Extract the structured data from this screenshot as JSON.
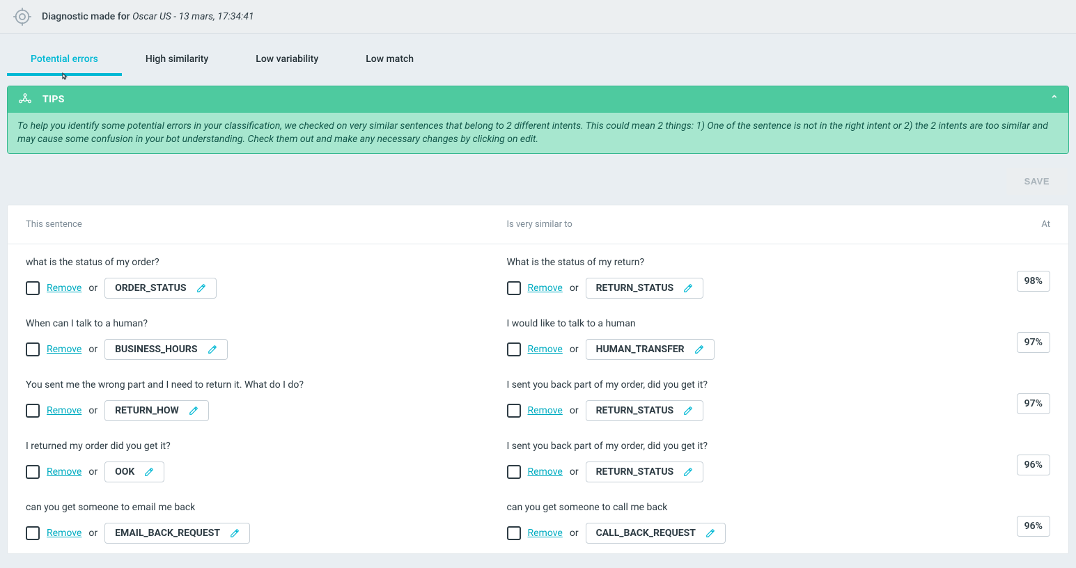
{
  "header": {
    "prefix": "Diagnostic made for ",
    "entity": "Oscar US - 13 mars, 17:34:41"
  },
  "tabs": [
    {
      "label": "Potential errors",
      "active": true
    },
    {
      "label": "High similarity",
      "active": false
    },
    {
      "label": "Low variability",
      "active": false
    },
    {
      "label": "Low match",
      "active": false
    }
  ],
  "tips": {
    "title": "TIPS",
    "body": "To help you identify some potential errors in your classification, we checked on very similar sentences that belong to 2 different intents. This could mean 2 things: 1) One of the sentence is not in the right intent or 2) the 2 intents are too similar and may cause some confusion in your bot understanding. Check them out and make any necessary changes by clicking on edit."
  },
  "buttons": {
    "save": "SAVE",
    "remove": "Remove",
    "or": "or"
  },
  "columns": {
    "left": "This sentence",
    "right": "Is very similar to",
    "score": "At"
  },
  "rows": [
    {
      "left_sentence": "what is the status of my order?",
      "left_intent": "ORDER_STATUS",
      "right_sentence": "What is the status of my return?",
      "right_intent": "RETURN_STATUS",
      "score": "98%"
    },
    {
      "left_sentence": "When can I talk to a human?",
      "left_intent": "BUSINESS_HOURS",
      "right_sentence": "I would like to talk to a human",
      "right_intent": "HUMAN_TRANSFER",
      "score": "97%"
    },
    {
      "left_sentence": "You sent me the wrong part and I need to return it. What do I do?",
      "left_intent": "RETURN_HOW",
      "right_sentence": "I sent you back part of my order, did you get it?",
      "right_intent": "RETURN_STATUS",
      "score": "97%"
    },
    {
      "left_sentence": "I returned my order did you get it?",
      "left_intent": "OOK",
      "right_sentence": "I sent you back part of my order, did you get it?",
      "right_intent": "RETURN_STATUS",
      "score": "96%"
    },
    {
      "left_sentence": "can you get someone to email me back",
      "left_intent": "EMAIL_BACK_REQUEST",
      "right_sentence": "can you get someone to call me back",
      "right_intent": "CALL_BACK_REQUEST",
      "score": "96%"
    }
  ]
}
